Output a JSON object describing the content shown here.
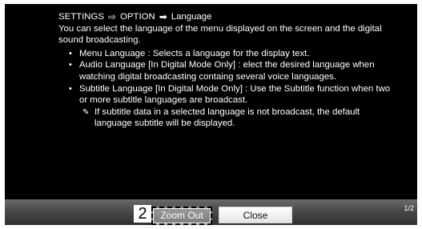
{
  "breadcrumb": {
    "settings": "SETTINGS",
    "option": "OPTION",
    "language": "Language"
  },
  "intro": "You can select the language of the menu displayed on the screen and the digital sound broadcasting.",
  "items": [
    "Menu Language : Selects a language for the display text.",
    "Audio Language  [In Digital Mode Only] : elect the desired language when watching digital broadcasting containg several voice languages.",
    "Subtitle Language [In Digital Mode Only] : Use the Subtitle function when two or more subtitle languages are broadcast."
  ],
  "note": "If subtitle data in a selected language is not broadcast, the default language subtitle will be displayed.",
  "footer": {
    "step_number": "2",
    "zoom_out_label": "Zoom Out",
    "close_label": "Close",
    "page_indicator": "1/2"
  },
  "icons": {
    "breadcrumb_arrow_1": "outline-right-arrow-icon",
    "breadcrumb_arrow_2": "solid-right-arrow-icon",
    "note": "note-icon"
  }
}
